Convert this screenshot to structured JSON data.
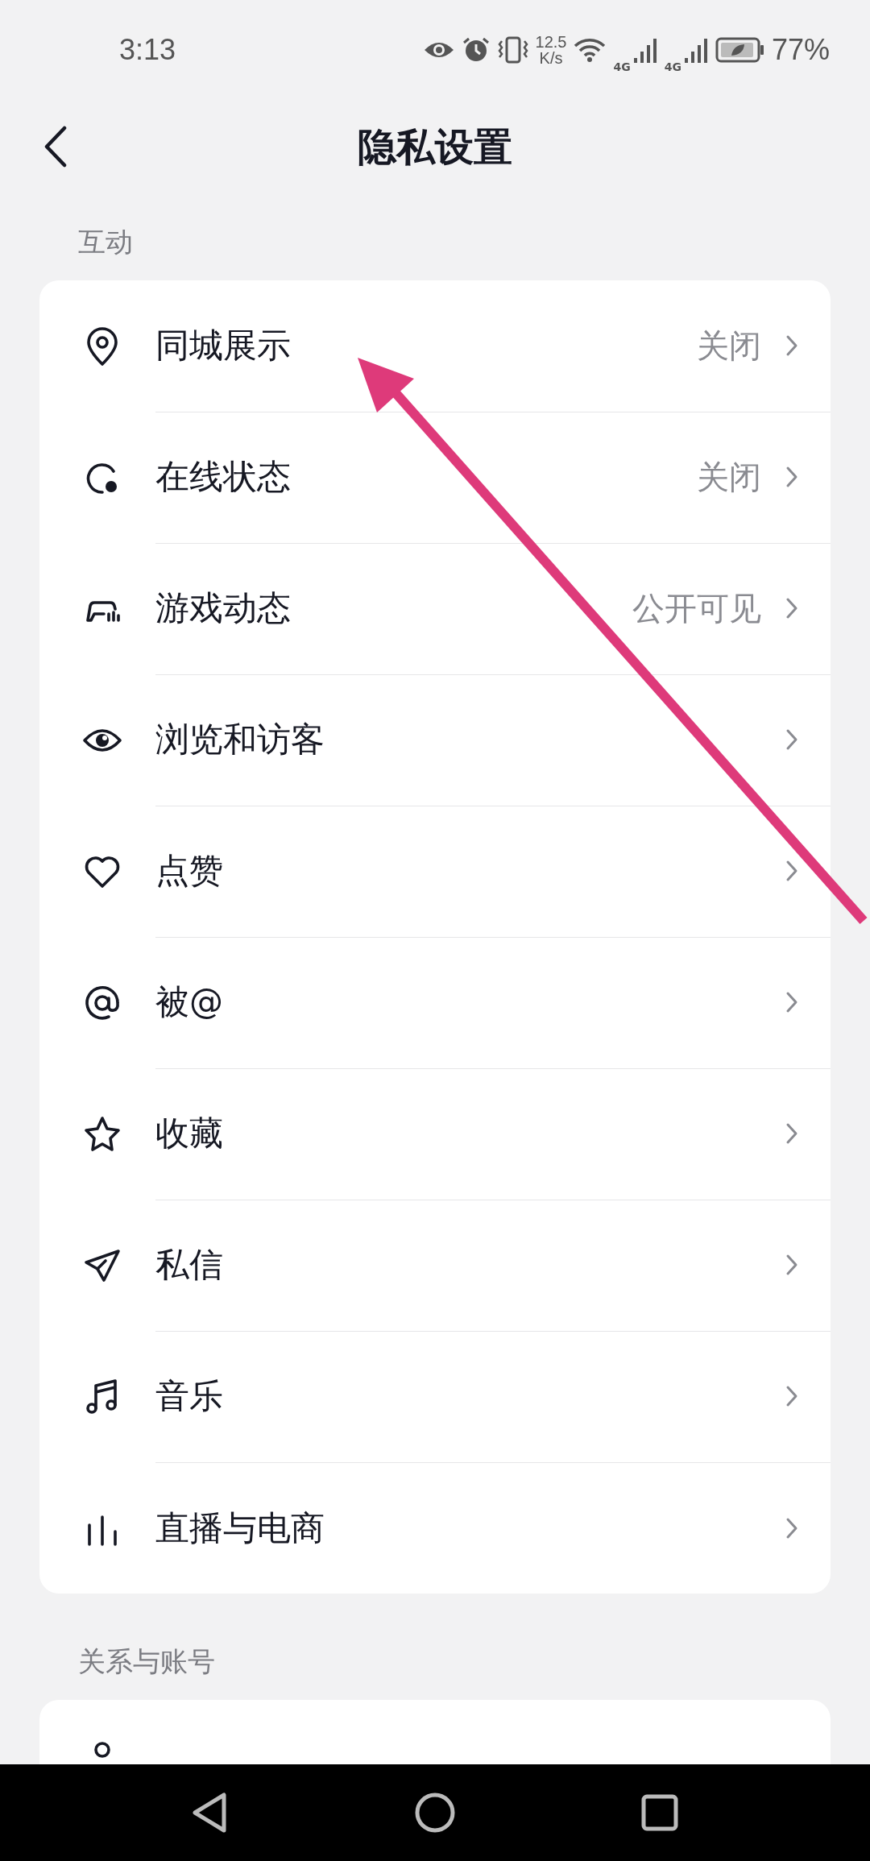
{
  "status_bar": {
    "time": "3:13",
    "speed_value": "12.5",
    "speed_unit": "K/s",
    "network_1": "4G",
    "network_2": "4G",
    "battery": "77%"
  },
  "header": {
    "title": "隐私设置"
  },
  "sections": [
    {
      "title": "互动",
      "rows": [
        {
          "kind": "pin",
          "label": "同城展示",
          "value": "关闭"
        },
        {
          "kind": "status",
          "label": "在线状态",
          "value": "关闭"
        },
        {
          "kind": "game",
          "label": "游戏动态",
          "value": "公开可见"
        },
        {
          "kind": "eye",
          "label": "浏览和访客"
        },
        {
          "kind": "heart",
          "label": "点赞"
        },
        {
          "kind": "at",
          "label": "被@"
        },
        {
          "kind": "star",
          "label": "收藏"
        },
        {
          "kind": "plane",
          "label": "私信"
        },
        {
          "kind": "music",
          "label": "音乐"
        },
        {
          "kind": "bars",
          "label": "直播与电商"
        }
      ]
    },
    {
      "title": "关系与账号"
    }
  ]
}
